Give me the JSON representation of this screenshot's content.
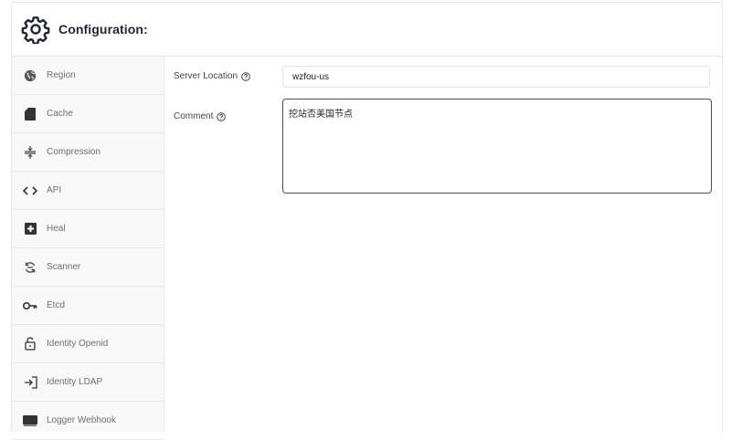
{
  "header": {
    "title": "Configuration:",
    "icon": "gear-icon"
  },
  "sidebar": {
    "items": [
      {
        "label": "Region",
        "icon": "globe-icon"
      },
      {
        "label": "Cache",
        "icon": "sd-card-icon"
      },
      {
        "label": "Compression",
        "icon": "compress-icon"
      },
      {
        "label": "API",
        "icon": "code-icon"
      },
      {
        "label": "Heal",
        "icon": "medical-cross-icon"
      },
      {
        "label": "Scanner",
        "icon": "scanner-refresh-icon"
      },
      {
        "label": "Etcd",
        "icon": "key-icon"
      },
      {
        "label": "Identity Openid",
        "icon": "unlock-icon"
      },
      {
        "label": "Identity LDAP",
        "icon": "login-icon"
      },
      {
        "label": "Logger Webhook",
        "icon": "webhook-icon"
      }
    ]
  },
  "form": {
    "server_location": {
      "label": "Server Location",
      "value": "wzfou-us"
    },
    "comment": {
      "label": "Comment",
      "value": "挖站否美国节点"
    }
  },
  "colors": {
    "title": "#1f2533",
    "sidebar_bg": "#f8f8f8",
    "textarea_border": "#4a4f57"
  }
}
